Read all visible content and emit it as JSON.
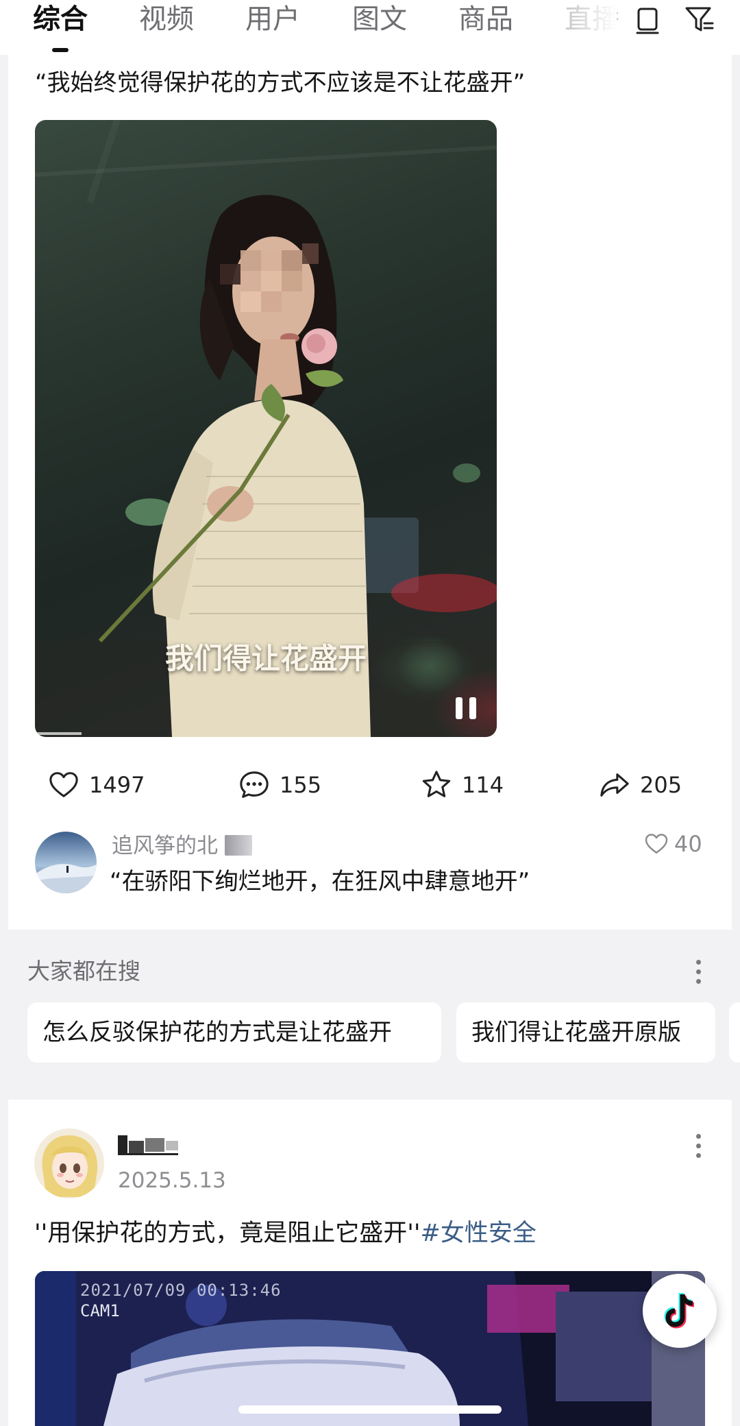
{
  "tabs": [
    {
      "label": "综合",
      "active": true
    },
    {
      "label": "视频"
    },
    {
      "label": "用户"
    },
    {
      "label": "图文"
    },
    {
      "label": "商品"
    },
    {
      "label": "直播"
    }
  ],
  "top_icons": [
    "rectangle-stack-icon",
    "filter-icon"
  ],
  "post1": {
    "title": "“我始终觉得保护花的方式不应该是不让花盛开”",
    "video_caption": "我们得让花盛开",
    "video_state": "playing",
    "stats": {
      "likes": "1497",
      "comments": "155",
      "favorites": "114",
      "shares": "205"
    },
    "top_comment": {
      "user": "追风筝的北",
      "text": "“在骄阳下绚烂地开，在狂风中肆意地开”",
      "likes": "40"
    }
  },
  "search_section": {
    "title": "大家都在搜",
    "chips": [
      "怎么反驳保护花的方式是让花盛开",
      "我们得让花盛开原版"
    ]
  },
  "post2": {
    "date": "2025.5.13",
    "text": "''用保护花的方式，竟是阻止它盛开''",
    "hashtag": "#女性安全",
    "cam_timestamp": "2021/07/09 00:13:46",
    "cam_label": "CAM1"
  },
  "colors": {
    "accent_link": "#3a5d86",
    "page_bg": "#f2f2f4",
    "card_bg": "#ffffff"
  }
}
